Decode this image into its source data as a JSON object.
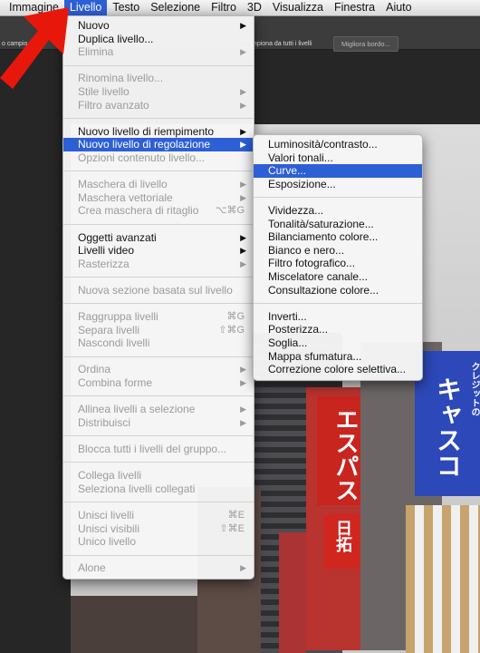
{
  "menubar": {
    "items": [
      {
        "label": "Immagine",
        "active": false
      },
      {
        "label": "Livello",
        "active": true
      },
      {
        "label": "Testo",
        "active": false
      },
      {
        "label": "Selezione",
        "active": false
      },
      {
        "label": "Filtro",
        "active": false
      },
      {
        "label": "3D",
        "active": false
      },
      {
        "label": "Visualizza",
        "active": false
      },
      {
        "label": "Finestra",
        "active": false
      },
      {
        "label": "Aiuto",
        "active": false
      }
    ]
  },
  "options_bar": {
    "left_text": "o campio",
    "sample_all_layers": "mpiona da tutti i livelli",
    "refine_edge_button": "Migliora bordo..."
  },
  "livello_menu": {
    "groups": [
      [
        {
          "label": "Nuovo",
          "enabled": true,
          "submenu": true
        },
        {
          "label": "Duplica livello...",
          "enabled": true
        },
        {
          "label": "Elimina",
          "enabled": false,
          "submenu": true
        }
      ],
      [
        {
          "label": "Rinomina livello...",
          "enabled": false
        },
        {
          "label": "Stile livello",
          "enabled": false,
          "submenu": true
        },
        {
          "label": "Filtro avanzato",
          "enabled": false,
          "submenu": true
        }
      ],
      [
        {
          "label": "Nuovo livello di riempimento",
          "enabled": true,
          "submenu": true
        },
        {
          "label": "Nuovo livello di regolazione",
          "enabled": true,
          "submenu": true,
          "highlighted": true
        },
        {
          "label": "Opzioni contenuto livello...",
          "enabled": false
        }
      ],
      [
        {
          "label": "Maschera di livello",
          "enabled": false,
          "submenu": true
        },
        {
          "label": "Maschera vettoriale",
          "enabled": false,
          "submenu": true
        },
        {
          "label": "Crea maschera di ritaglio",
          "enabled": false,
          "shortcut": "⌥⌘G"
        }
      ],
      [
        {
          "label": "Oggetti avanzati",
          "enabled": true,
          "submenu": true
        },
        {
          "label": "Livelli video",
          "enabled": true,
          "submenu": true
        },
        {
          "label": "Rasterizza",
          "enabled": false,
          "submenu": true
        }
      ],
      [
        {
          "label": "Nuova sezione basata sul livello",
          "enabled": false
        }
      ],
      [
        {
          "label": "Raggruppa livelli",
          "enabled": false,
          "shortcut": "⌘G"
        },
        {
          "label": "Separa livelli",
          "enabled": false,
          "shortcut": "⇧⌘G"
        },
        {
          "label": "Nascondi livelli",
          "enabled": false
        }
      ],
      [
        {
          "label": "Ordina",
          "enabled": false,
          "submenu": true
        },
        {
          "label": "Combina forme",
          "enabled": false,
          "submenu": true
        }
      ],
      [
        {
          "label": "Allinea livelli a selezione",
          "enabled": false,
          "submenu": true
        },
        {
          "label": "Distribuisci",
          "enabled": false,
          "submenu": true
        }
      ],
      [
        {
          "label": "Blocca tutti i livelli del gruppo...",
          "enabled": false
        }
      ],
      [
        {
          "label": "Collega livelli",
          "enabled": false
        },
        {
          "label": "Seleziona livelli collegati",
          "enabled": false
        }
      ],
      [
        {
          "label": "Unisci livelli",
          "enabled": false,
          "shortcut": "⌘E"
        },
        {
          "label": "Unisci visibili",
          "enabled": false,
          "shortcut": "⇧⌘E"
        },
        {
          "label": "Unico livello",
          "enabled": false
        }
      ],
      [
        {
          "label": "Alone",
          "enabled": false,
          "submenu": true
        }
      ]
    ]
  },
  "adjustment_submenu": {
    "groups": [
      [
        {
          "label": "Luminosità/contrasto..."
        },
        {
          "label": "Valori tonali..."
        },
        {
          "label": "Curve...",
          "highlighted": true
        },
        {
          "label": "Esposizione..."
        }
      ],
      [
        {
          "label": "Vividezza..."
        },
        {
          "label": "Tonalità/saturazione..."
        },
        {
          "label": "Bilanciamento colore..."
        },
        {
          "label": "Bianco e nero..."
        },
        {
          "label": "Filtro fotografico..."
        },
        {
          "label": "Miscelatore canale..."
        },
        {
          "label": "Consultazione colore..."
        }
      ],
      [
        {
          "label": "Inverti..."
        },
        {
          "label": "Posterizza..."
        },
        {
          "label": "Soglia..."
        },
        {
          "label": "Mappa sfumatura..."
        },
        {
          "label": "Correzione colore selettiva..."
        }
      ]
    ]
  },
  "photo_signs": {
    "sign1": "エスパス",
    "sign2": "日拓",
    "sign3": "キャスコ",
    "sign4": "クレジットの"
  },
  "colors": {
    "highlight": "#2d5fd6",
    "arrow": "#e8170c"
  },
  "icons": {
    "submenu_arrow": "▶",
    "pointer_arrow": "red-arrow"
  }
}
